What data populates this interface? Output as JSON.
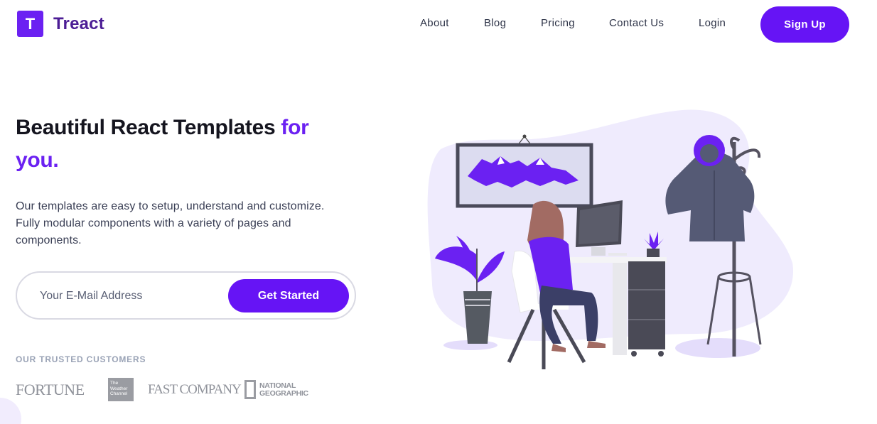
{
  "brand": {
    "logo_letter": "T",
    "name": "Treact",
    "accent": "#6b21f2"
  },
  "nav": {
    "links": [
      "About",
      "Blog",
      "Pricing",
      "Contact Us",
      "Login"
    ],
    "signup_label": "Sign Up"
  },
  "hero": {
    "title_main": "Beautiful React Templates ",
    "title_accent": "for you.",
    "description": "Our templates are easy to setup, understand and customize. Fully modular components with a variety of pages and components.",
    "email_placeholder": "Your E-Mail Address",
    "cta_label": "Get Started"
  },
  "customers": {
    "title": "OUR TRUSTED CUSTOMERS",
    "fortune": "FORTUNE",
    "weather": "The Weather Channel",
    "fastcompany": "FAST COMPANY",
    "natgeo": "NATIONAL GEOGRAPHIC"
  },
  "illustration": {
    "icon": "person-at-desk-illustration"
  }
}
